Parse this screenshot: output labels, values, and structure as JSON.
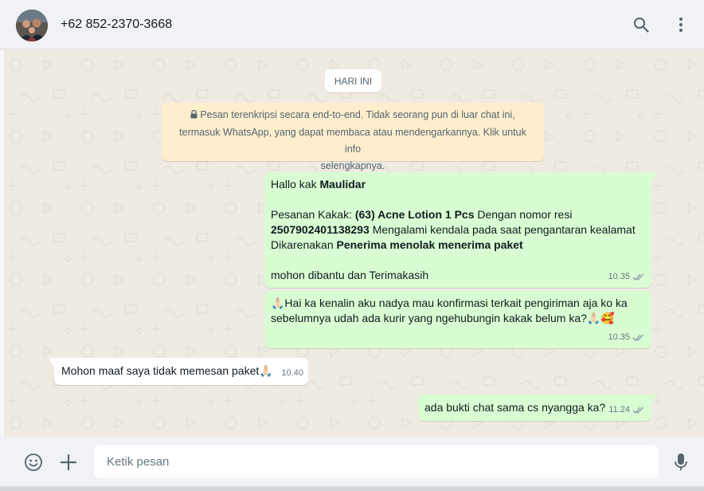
{
  "header": {
    "contact_name": "+62 852-2370-3668",
    "icons": [
      "avatar",
      "search-icon",
      "menu-icon"
    ]
  },
  "chat": {
    "date_label": "HARI INI",
    "encryption_notice": {
      "line1": "Pesan terenkripsi secara end-to-end. Tidak seorang pun di luar chat ini,",
      "line2": "termasuk WhatsApp, yang dapat membaca atau mendengarkannya. Klik untuk info",
      "line3": "selengkapnya."
    },
    "messages": [
      {
        "direction": "outgoing",
        "greeting": "Hallo kak ",
        "greeting_name": "Maulidar",
        "order_prefix": "Pesanan Kakak: ",
        "order_item": "(63) Acne Lotion 1 Pcs",
        "order_mid": " Dengan nomor resi",
        "resi": "2507902401138293",
        "resi_suffix": " Mengalami kendala pada saat pengantaran kealamat",
        "reason_prefix": "Dikarenakan ",
        "reason": "Penerima menolak menerima paket",
        "closing": " mohon dibantu dan Terimakasih",
        "time": "10.35",
        "status": "read"
      },
      {
        "direction": "outgoing",
        "line1": "🙏🏻Hai ka kenalin aku nadya mau konfirmasi terkait pengiriman aja ko ka",
        "line2": "sebelumnya udah ada kurir yang ngehubungin kakak belum ka?🙏🏻🥰",
        "time": "10.35",
        "status": "read"
      },
      {
        "direction": "incoming",
        "text": "Mohon maaf saya tidak memesan paket🙏🏻",
        "time": "10.40"
      },
      {
        "direction": "outgoing",
        "text": "ada bukti chat sama cs nyangga ka?",
        "time": "11.24",
        "status": "read"
      }
    ]
  },
  "footer": {
    "input_placeholder": "Ketik pesan",
    "icons": [
      "emoji-icon",
      "attach-plus-icon",
      "microphone-icon"
    ]
  },
  "colors": {
    "outgoing_bubble": "#d9fdd3",
    "incoming_bubble": "#ffffff",
    "notice_bg": "#ffeecd",
    "chat_bg": "#efeae2",
    "bar_bg": "#f0f2f5"
  }
}
